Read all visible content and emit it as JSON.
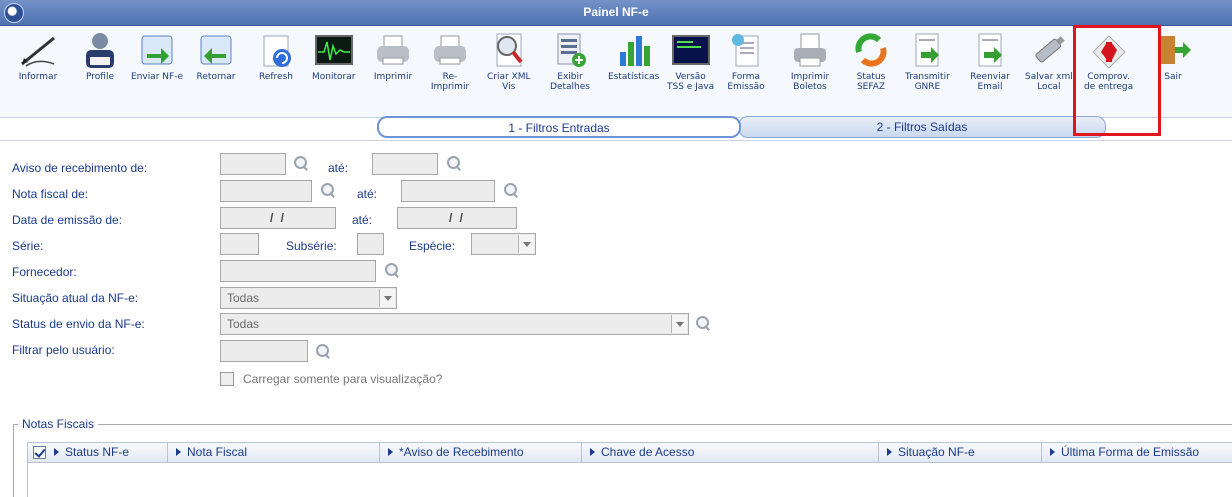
{
  "window": {
    "title": "Painel NF-e"
  },
  "toolbar": {
    "items": [
      {
        "id": "informar",
        "label": "Informar",
        "icon": "pen-icon"
      },
      {
        "id": "profile",
        "label": "Profile",
        "icon": "profile-icon"
      },
      {
        "id": "enviar",
        "label": "Enviar NF-e",
        "icon": "send-arrow-icon"
      },
      {
        "id": "retornar",
        "label": "Retornar",
        "icon": "return-arrow-icon"
      },
      {
        "id": "refresh",
        "label": "Refresh",
        "icon": "refresh-icon"
      },
      {
        "id": "monitorar",
        "label": "Monitorar",
        "icon": "monitor-icon"
      },
      {
        "id": "imprimir",
        "label": "Imprimir",
        "icon": "printer-icon"
      },
      {
        "id": "reimprimir",
        "label": "Re-\nImprimir",
        "icon": "printer-icon"
      },
      {
        "id": "criarxml",
        "label": "Criar XML\nVis",
        "icon": "magnifier-doc-icon"
      },
      {
        "id": "exibir",
        "label": "Exibir\nDetalhes",
        "icon": "details-icon"
      },
      {
        "id": "estatisticas",
        "label": "Estatísticas",
        "icon": "chart-icon"
      },
      {
        "id": "versao",
        "label": "Versão\nTSS e Java",
        "icon": "terminal-icon"
      },
      {
        "id": "forma",
        "label": "Forma\nEmissão",
        "icon": "form-icon"
      },
      {
        "id": "boletos",
        "label": "Imprimir\nBoletos",
        "icon": "print-boletos-icon"
      },
      {
        "id": "status",
        "label": "Status\nSEFAZ",
        "icon": "status-icon"
      },
      {
        "id": "transmitir",
        "label": "Transmitir\nGNRE",
        "icon": "transmit-doc-icon"
      },
      {
        "id": "reenviar",
        "label": "Reenviar\nEmail",
        "icon": "resend-doc-icon"
      },
      {
        "id": "salvar",
        "label": "Salvar xml\nLocal",
        "icon": "usb-drive-icon"
      },
      {
        "id": "comprov",
        "label": "Comprov.\nde entrega",
        "icon": "delivery-receipt-icon"
      },
      {
        "id": "sair",
        "label": "Sair",
        "icon": "exit-door-icon"
      }
    ]
  },
  "tabs": [
    {
      "label": "1 - Filtros Entradas",
      "active": true
    },
    {
      "label": "2 - Filtros Saídas",
      "active": false
    }
  ],
  "form": {
    "aviso_label": "Aviso de recebimento de:",
    "ate": "até:",
    "nota_label": "Nota fiscal de:",
    "data_label": "Data de emissão de:",
    "data_de_value": "/ /",
    "data_ate_value": "/ /",
    "serie_label": "Série:",
    "subserie_label": "Subsérie:",
    "especie_label": "Espécie:",
    "fornecedor_label": "Fornecedor:",
    "situacao_label": "Situação atual da NF-e:",
    "situacao_value": "Todas",
    "status_label": "Status de envio da NF-e:",
    "status_value": "Todas",
    "filtrar_label": "Filtrar pelo usuário:",
    "carregar_label": "Carregar somente para visualização?"
  },
  "grid": {
    "group_title": "Notas Fiscais",
    "columns": [
      "Status NF-e",
      "Nota Fiscal",
      "*Aviso de Recebimento",
      "Chave de Acesso",
      "Situação NF-e",
      "Última Forma de Emissão"
    ]
  },
  "colors": {
    "title_bar": "#5b7cbd",
    "label_text": "#1a3a8a",
    "highlight": "#e1161d"
  }
}
